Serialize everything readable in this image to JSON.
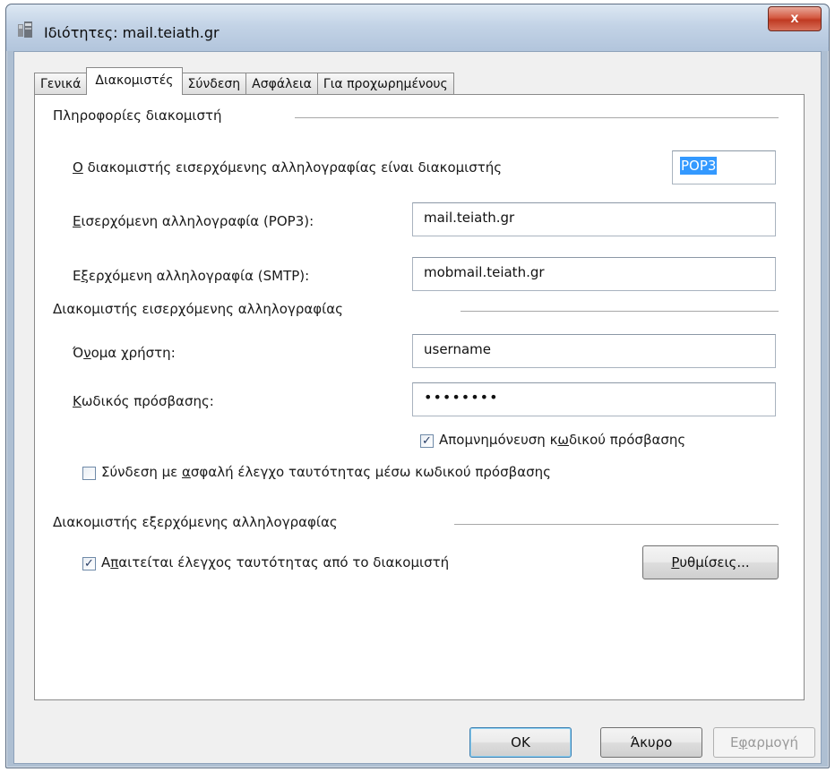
{
  "window": {
    "title": "Ιδιότητες: mail.teiath.gr",
    "close_label": "x"
  },
  "tabs": [
    {
      "label": "Γενικά",
      "active": false
    },
    {
      "label": "Διακομιστές",
      "active": true
    },
    {
      "label": "Σύνδεση",
      "active": false
    },
    {
      "label": "Ασφάλεια",
      "active": false
    },
    {
      "label": "Για προχωρημένους",
      "active": false
    }
  ],
  "server_info": {
    "heading": "Πληροφορίες διακομιστή",
    "incoming_type": {
      "label_accel": "Ο",
      "label_rest": " διακομιστής εισερχόμενης αλληλογραφίας είναι διακομιστής",
      "value": "POP3"
    },
    "incoming": {
      "label_accel": "Ε",
      "label_rest": "ισερχόμενη αλληλογραφία (POP3):",
      "value": "mail.teiath.gr"
    },
    "outgoing": {
      "label_pre": "Ε",
      "label_accel": "ξ",
      "label_rest": "ερχόμενη αλληλογραφία (SMTP):",
      "value": "mobmail.teiath.gr"
    }
  },
  "incoming_server": {
    "heading": "Διακομιστής εισερχόμενης αλληλογραφίας",
    "username": {
      "label_pre": "Ό",
      "label_accel": "ν",
      "label_rest": "ομα χρήστη:",
      "value": "username"
    },
    "password": {
      "label_accel": "Κ",
      "label_rest": "ωδικός πρόσβασης:",
      "value": "••••••••"
    },
    "remember_password": {
      "label_pre": "Απομνημόνευση κ",
      "label_accel": "ω",
      "label_rest": "δικού πρόσβασης",
      "checked": true
    },
    "spa": {
      "label_pre": "Σύνδεση με ",
      "label_accel": "α",
      "label_rest": "σφαλή έλεγχο ταυτότητας μέσω κωδικού πρόσβασης",
      "checked": false
    }
  },
  "outgoing_server": {
    "heading": "Διακομιστής εξερχόμενης αλληλογραφίας",
    "auth_required": {
      "label_pre": "Α",
      "label_accel": "π",
      "label_rest": "αιτείται έλεγχος ταυτότητας από το διακομιστή",
      "checked": true
    },
    "settings_button": {
      "label_accel": "Ρ",
      "label_rest": "υθμίσεις..."
    }
  },
  "footer": {
    "ok": "OK",
    "cancel": "Άκυρο",
    "apply_pre": "Ε",
    "apply_accel": "φ",
    "apply_rest": "αρμογή"
  }
}
